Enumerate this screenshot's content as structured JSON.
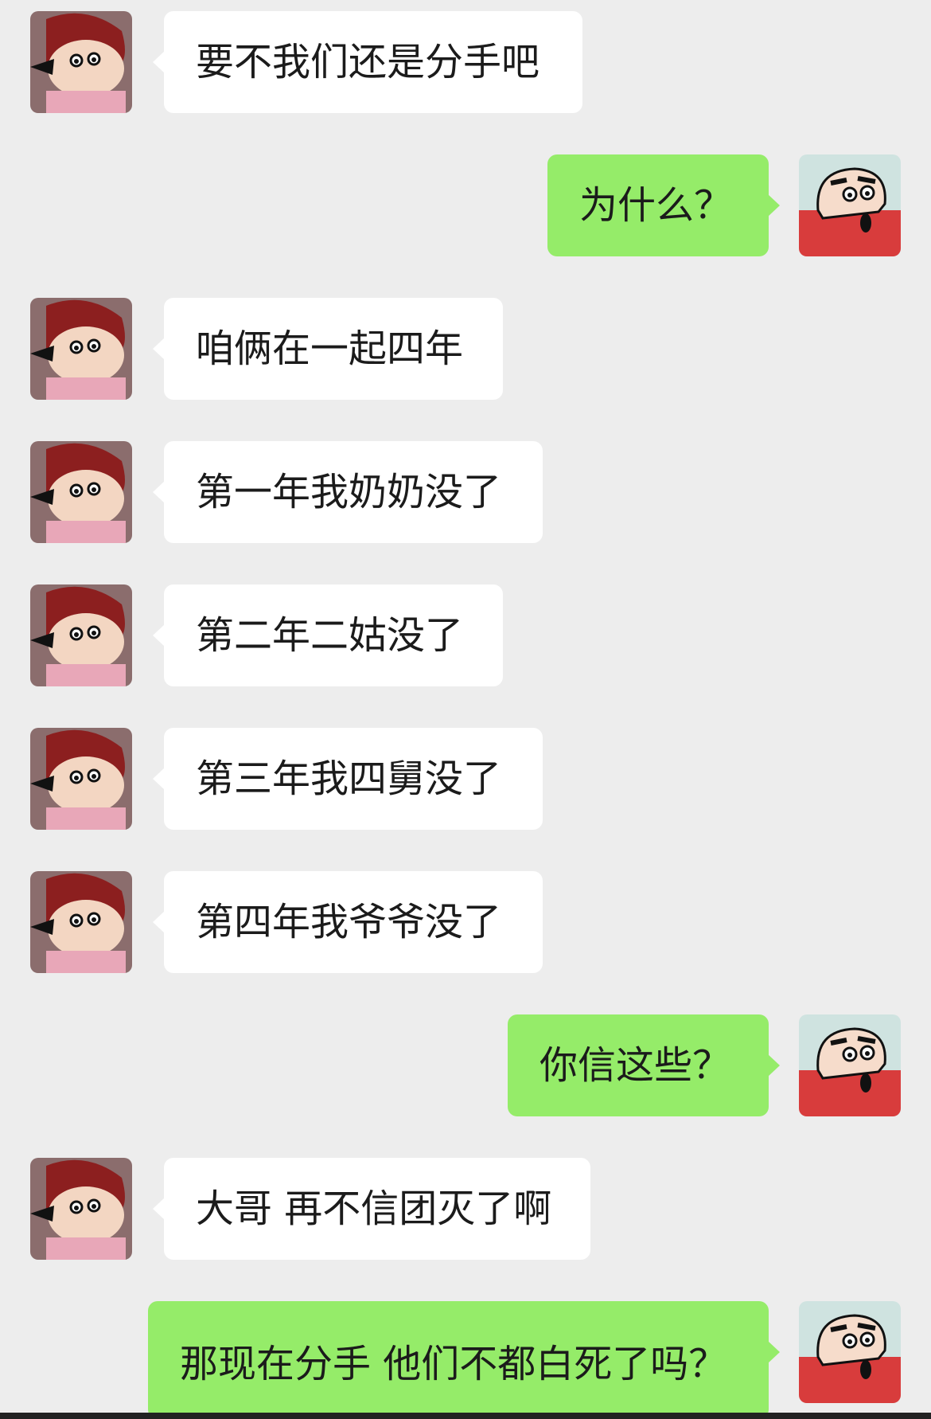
{
  "chat": {
    "messages": [
      {
        "side": "in",
        "text": "要不我们还是分手吧"
      },
      {
        "side": "out",
        "text": "为什么？"
      },
      {
        "side": "in",
        "text": "咱俩在一起四年"
      },
      {
        "side": "in",
        "text": "第一年我奶奶没了"
      },
      {
        "side": "in",
        "text": "第二年二姑没了"
      },
      {
        "side": "in",
        "text": "第三年我四舅没了"
      },
      {
        "side": "in",
        "text": "第四年我爷爷没了"
      },
      {
        "side": "out",
        "text": "你信这些？"
      },
      {
        "side": "in",
        "text": "大哥 再不信团灭了啊"
      },
      {
        "side": "out",
        "text": "那现在分手 他们不都白死了吗？"
      }
    ]
  },
  "colors": {
    "background": "#ededed",
    "incoming_bubble": "#ffffff",
    "outgoing_bubble": "#95ec69"
  },
  "icons": {
    "incoming_avatar": "cartoon-girl-avatar-icon",
    "outgoing_avatar": "cartoon-boy-avatar-icon"
  }
}
